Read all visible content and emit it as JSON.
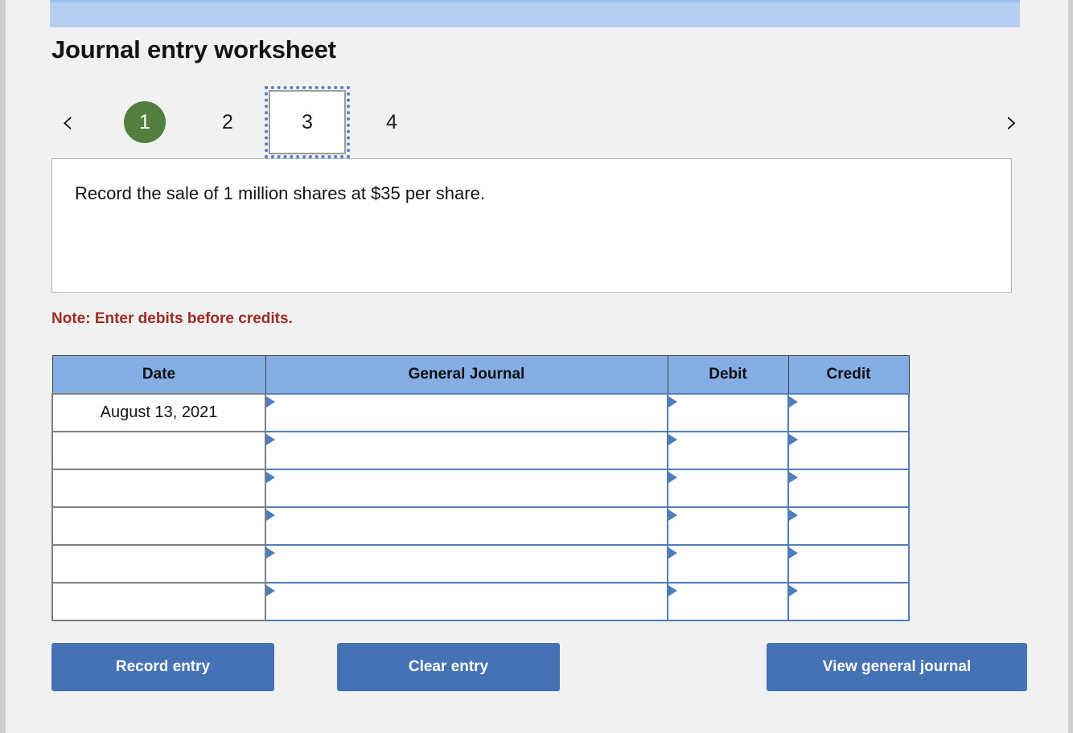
{
  "banner": {
    "present": true,
    "color": "#b4cff2"
  },
  "header": {
    "title": "Journal entry worksheet"
  },
  "pager": {
    "prev_icon": "chevron-left-icon",
    "next_icon": "chevron-right-icon",
    "prev_label": "‹",
    "next_label": "›",
    "steps": [
      {
        "label": "1",
        "state": "current"
      },
      {
        "label": "2",
        "state": "normal"
      },
      {
        "label": "3",
        "state": "focused"
      },
      {
        "label": "4",
        "state": "normal"
      }
    ],
    "current_step_color": "#527e3f",
    "focus_outline_color": "#5580c0"
  },
  "prompt": {
    "text": "Record the sale of 1 million shares at $35 per share."
  },
  "note": {
    "text": "Note: Enter debits before credits.",
    "color": "#9c2b23"
  },
  "journal": {
    "columns": [
      "Date",
      "General Journal",
      "Debit",
      "Credit"
    ],
    "header_color": "#85aee5",
    "rows": [
      {
        "date": "August 13, 2021",
        "general_journal": "",
        "debit": "",
        "credit": ""
      },
      {
        "date": "",
        "general_journal": "",
        "debit": "",
        "credit": ""
      },
      {
        "date": "",
        "general_journal": "",
        "debit": "",
        "credit": ""
      },
      {
        "date": "",
        "general_journal": "",
        "debit": "",
        "credit": ""
      },
      {
        "date": "",
        "general_journal": "",
        "debit": "",
        "credit": ""
      },
      {
        "date": "",
        "general_journal": "",
        "debit": "",
        "credit": ""
      }
    ]
  },
  "actions": {
    "record_label": "Record entry",
    "clear_label": "Clear entry",
    "view_label": "View general journal",
    "button_color": "#4472b4"
  }
}
